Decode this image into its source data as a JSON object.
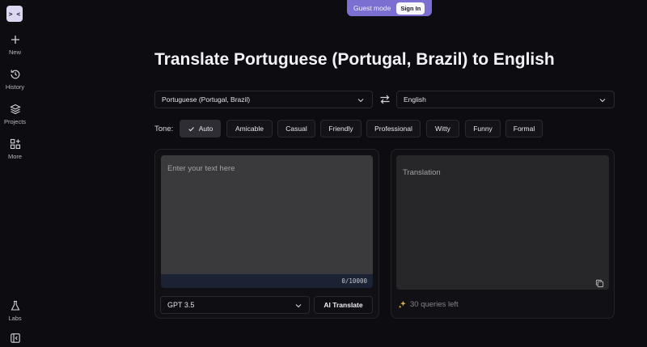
{
  "sidebar": {
    "logo": "> <",
    "items": [
      {
        "icon": "plus-icon",
        "label": "New"
      },
      {
        "icon": "history-icon",
        "label": "History"
      },
      {
        "icon": "layers-icon",
        "label": "Projects"
      },
      {
        "icon": "grid-plus-icon",
        "label": "More"
      }
    ],
    "labs": {
      "icon": "flask-icon",
      "label": "Labs"
    },
    "collapse_icon": "collapse-sidebar-icon"
  },
  "guest": {
    "mode_text": "Guest mode",
    "sign_in": "Sign In"
  },
  "title": "Translate Portuguese (Portugal, Brazil) to English",
  "source_language": "Portuguese (Portugal, Brazil)",
  "target_language": "English",
  "tone": {
    "label": "Tone:",
    "options": [
      "Auto",
      "Amicable",
      "Casual",
      "Friendly",
      "Professional",
      "Witty",
      "Funny",
      "Formal"
    ],
    "selected": "Auto"
  },
  "input": {
    "placeholder": "Enter your text here",
    "value": "",
    "counter": "0/10000"
  },
  "output": {
    "placeholder": "Translation"
  },
  "model": {
    "selected": "GPT 3.5"
  },
  "translate_button": "AI Translate",
  "queries_left": "30 queries left",
  "colors": {
    "accent": "#7b6fd1",
    "background": "#0d0c10",
    "panel": "#111015"
  }
}
